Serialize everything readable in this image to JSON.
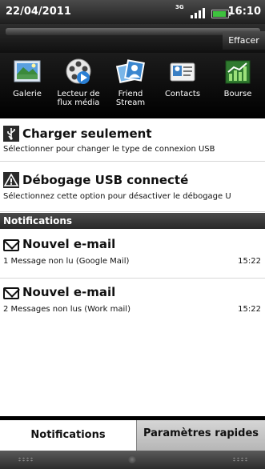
{
  "status_bar": {
    "date": "22/04/2011",
    "time": "16:10",
    "network": "3G",
    "icons": [
      "3g-icon",
      "signal-icon",
      "battery-icon"
    ]
  },
  "header": {
    "clear_label": "Effacer"
  },
  "apps": [
    {
      "label": "Galerie",
      "icon": "gallery-icon"
    },
    {
      "label": "Lecteur de flux média",
      "icon": "media-player-icon"
    },
    {
      "label": "Friend Stream",
      "icon": "friend-stream-icon"
    },
    {
      "label": "Contacts",
      "icon": "contacts-icon"
    },
    {
      "label": "Bourse",
      "icon": "stocks-icon"
    }
  ],
  "usb": {
    "title": "Charger seulement",
    "desc": "Sélectionner pour changer le type de connexion USB"
  },
  "debug": {
    "title": "Débogage USB connecté",
    "desc": "Sélectionnez cette option pour désactiver le débogage U"
  },
  "notifications_header": "Notifications",
  "notifications": [
    {
      "title": "Nouvel e-mail",
      "sub": "1 Message non lu (Google Mail)",
      "time": "15:22"
    },
    {
      "title": "Nouvel e-mail",
      "sub": "2 Messages non lus (Work mail)",
      "time": "15:22"
    }
  ],
  "tabs": {
    "notifications": "Notifications",
    "quick_settings": "Paramètres rapides"
  }
}
